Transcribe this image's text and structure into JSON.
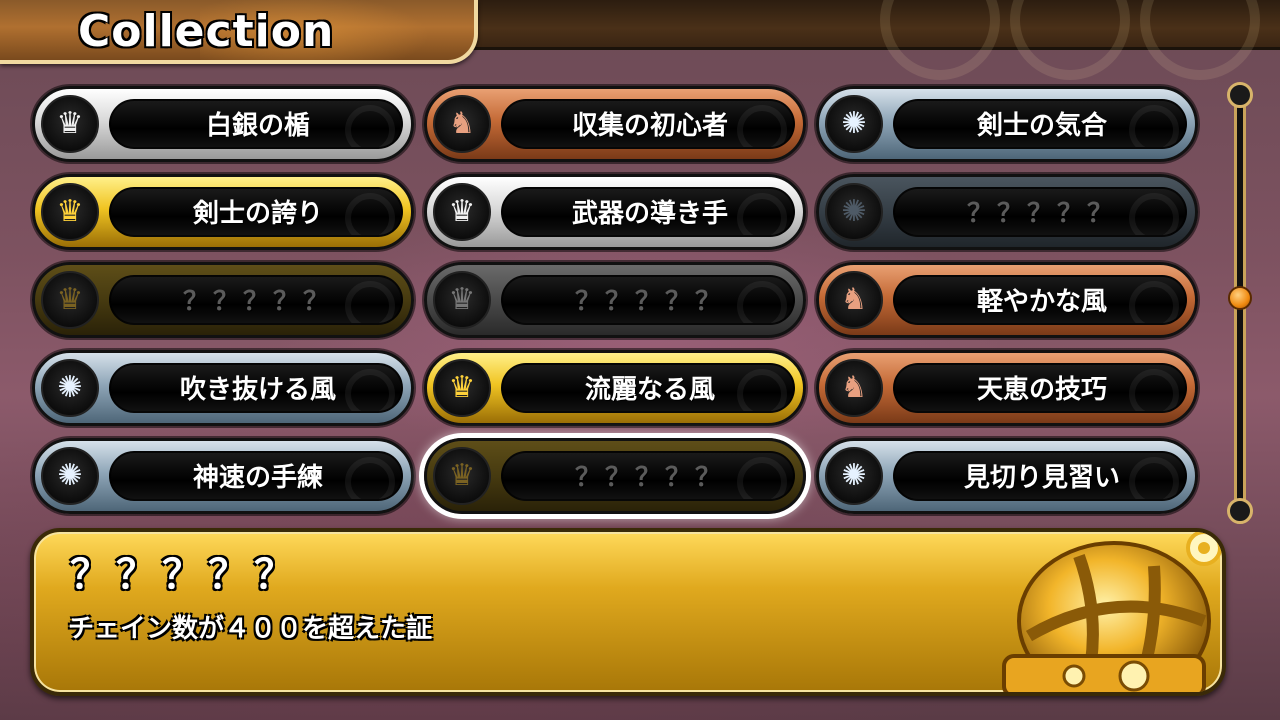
{
  "header": {
    "title": "Collection"
  },
  "grid": {
    "cells": [
      {
        "label": "白銀の楯",
        "tier": "silver",
        "icon": "crown-icon",
        "glyph": "♛"
      },
      {
        "label": "収集の初心者",
        "tier": "bronze",
        "icon": "lion-crest-icon",
        "glyph": "♞"
      },
      {
        "label": "剣士の気合",
        "tier": "blue",
        "icon": "sun-emblem-icon",
        "glyph": "✺"
      },
      {
        "label": "剣士の誇り",
        "tier": "gold",
        "icon": "crown-icon",
        "glyph": "♛"
      },
      {
        "label": "武器の導き手",
        "tier": "silver",
        "icon": "crown-icon",
        "glyph": "♛"
      },
      {
        "label": "？？？？？",
        "tier": "locked-blue",
        "icon": "sun-emblem-icon",
        "glyph": "✺"
      },
      {
        "label": "？？？？？",
        "tier": "locked-gold",
        "icon": "crown-icon",
        "glyph": "♛"
      },
      {
        "label": "？？？？？",
        "tier": "locked-silver",
        "icon": "crown-icon",
        "glyph": "♛"
      },
      {
        "label": "軽やかな風",
        "tier": "bronze",
        "icon": "lion-crest-icon",
        "glyph": "♞"
      },
      {
        "label": "吹き抜ける風",
        "tier": "blue",
        "icon": "sun-emblem-icon",
        "glyph": "✺"
      },
      {
        "label": "流麗なる風",
        "tier": "gold",
        "icon": "crown-icon",
        "glyph": "♛"
      },
      {
        "label": "天恵の技巧",
        "tier": "bronze",
        "icon": "lion-crest-icon",
        "glyph": "♞"
      },
      {
        "label": "神速の手練",
        "tier": "blue",
        "icon": "sun-emblem-icon",
        "glyph": "✺"
      },
      {
        "label": "？？？？？",
        "tier": "locked-gold",
        "icon": "crown-icon",
        "glyph": "♛",
        "selected": true
      },
      {
        "label": "見切り見習い",
        "tier": "blue",
        "icon": "sun-emblem-icon",
        "glyph": "✺"
      }
    ]
  },
  "scrollbar": {
    "position_fraction": 0.5
  },
  "detail": {
    "name": "？？？？？",
    "description": "チェイン数が４００を超えた証",
    "icon": "gold-crown-icon"
  }
}
